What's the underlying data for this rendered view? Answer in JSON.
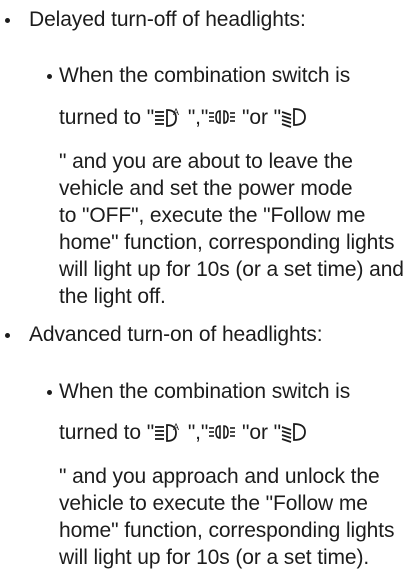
{
  "sections": [
    {
      "heading": "Delayed turn-off of headlights:",
      "sub": {
        "line1": "When the combination switch is",
        "line2": {
          "before": "turned to \"",
          "sep1": " \",\"",
          "sep2": " \"or \""
        },
        "lines": [
          "\" and you are about to leave the",
          "vehicle and set the power mode",
          "to \"OFF\", execute the \"Follow me",
          "home\" function, corresponding lights",
          "will light up for 10s (or a set time) and",
          "the light off."
        ]
      }
    },
    {
      "heading": "Advanced turn-on of headlights:",
      "sub": {
        "line1": "When the combination switch is",
        "line2": {
          "before": "turned to \"",
          "sep1": " \",\"",
          "sep2": " \"or \""
        },
        "lines": [
          "\" and you approach and unlock the",
          "vehicle to execute the \"Follow me",
          "home\" function, corresponding lights",
          "will light up for 10s (or a set time)."
        ]
      }
    }
  ],
  "icons": {
    "auto_headlight": "auto-headlight-icon",
    "position_light": "position-light-icon",
    "low_beam": "low-beam-icon"
  }
}
